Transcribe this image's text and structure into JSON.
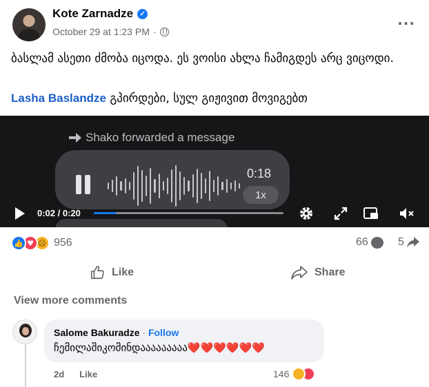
{
  "post": {
    "author": "Kote Zarnadze",
    "timestamp": "October 29 at 1:23 PM",
    "privacy_separator": "·",
    "text_line1": "ბასლამ ასეთი ძმობა იცოდა. ეს ვოისი ახლა ჩამიგდეს არც ვიცოდი.",
    "mention": "Lasha Baslandze",
    "text_line2": " გპირდები, სულ გიჟივით მოვიგებთ"
  },
  "video": {
    "forwarded_label": "Shako forwarded a message",
    "voice_duration": "0:18",
    "voice_speed": "1x",
    "current_time": "0:02 / 0:20",
    "progress_fraction": 0.12
  },
  "stats": {
    "reaction_count": "956",
    "comment_count": "66",
    "share_count": "5"
  },
  "actions": {
    "like": "Like",
    "share": "Share",
    "view_more_comments": "View more comments"
  },
  "comment": {
    "author": "Salome Bakuradze",
    "separator": "·",
    "follow": "Follow",
    "text": "ჩემილაშიკომინდააააააააა",
    "hearts": "❤️❤️❤️❤️❤️❤️",
    "age": "2d",
    "like": "Like",
    "reaction_count": "146"
  },
  "colors": {
    "accent": "#1877f2",
    "mention": "#1b5fc9",
    "muted_text": "#65676b",
    "video_bg": "#151617"
  },
  "icons": {
    "more": "more-horizontal-icon",
    "verified": "verified-badge-icon",
    "privacy": "globe-icon",
    "forward": "forward-arrow-icon",
    "pause": "pause-icon",
    "play": "play-icon",
    "settings": "gear-icon",
    "fullscreen": "expand-icon",
    "pip": "picture-in-picture-icon",
    "mute": "mute-icon"
  }
}
